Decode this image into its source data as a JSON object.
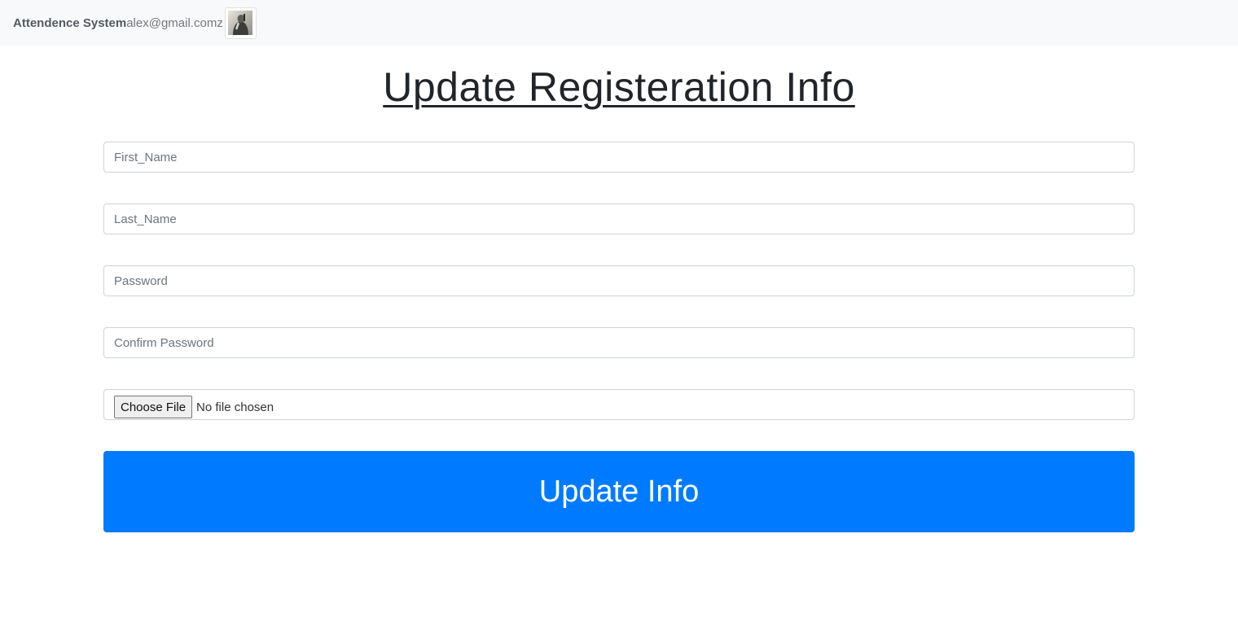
{
  "navbar": {
    "brand": "Attendence System",
    "email": "alex@gmail.comz",
    "avatar_icon": "user-avatar-icon"
  },
  "page": {
    "title": "Update Registeration Info"
  },
  "form": {
    "first_name_placeholder": "First_Name",
    "last_name_placeholder": "Last_Name",
    "password_placeholder": "Password",
    "confirm_password_placeholder": "Confirm Password",
    "file_button_label": "Choose File",
    "file_status": "No file chosen",
    "submit_label": "Update Info"
  },
  "colors": {
    "navbar_bg": "#f8f9fa",
    "primary": "#007bff",
    "text": "#212529",
    "border": "#ced4da"
  }
}
